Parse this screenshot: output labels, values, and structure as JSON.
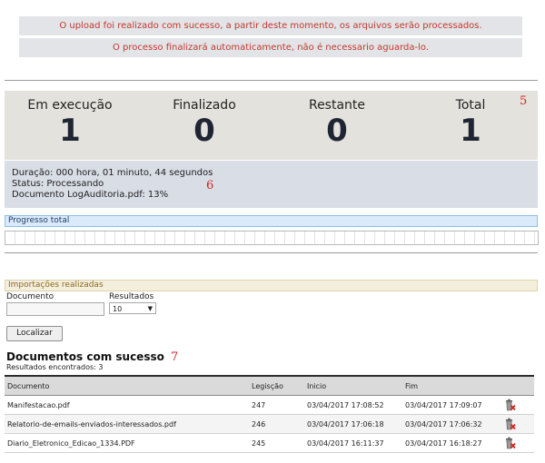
{
  "messages": [
    "O upload foi realizado com sucesso, a partir deste momento, os arquivos serão processados.",
    "O processo finalizará automaticamente, não é necessario aguarda-lo."
  ],
  "stats": {
    "em_execucao": {
      "label": "Em execução",
      "value": "1"
    },
    "finalizado": {
      "label": "Finalizado",
      "value": "0"
    },
    "restante": {
      "label": "Restante",
      "value": "0"
    },
    "total": {
      "label": "Total",
      "value": "1"
    }
  },
  "annotations": {
    "stats": "5",
    "info": "6",
    "documents": "7"
  },
  "info": {
    "duracao": "Duração: 000 hora, 01 minuto, 44 segundos",
    "status": "Status: Processando",
    "documento": "Documento LogAuditoria.pdf: 13%"
  },
  "progress": {
    "label": "Progresso total"
  },
  "importacoes": {
    "header": "Importações realizadas",
    "documento_label": "Documento",
    "documento_value": "",
    "resultados_label": "Resultados",
    "resultados_value": "10",
    "search_button": "Localizar"
  },
  "documents": {
    "title": "Documentos com sucesso",
    "count": "Resultados encontrados: 3",
    "columns": [
      "Documento",
      "Legisção",
      "Inicio",
      "Fim"
    ],
    "rows": [
      {
        "documento": "Manifestacao.pdf",
        "legiscao": "247",
        "inicio": "03/04/2017 17:08:52",
        "fim": "03/04/2017 17:09:07"
      },
      {
        "documento": "Relatorio-de-emails-enviados-interessados.pdf",
        "legiscao": "246",
        "inicio": "03/04/2017 17:06:18",
        "fim": "03/04/2017 17:06:32"
      },
      {
        "documento": "Diario_Eletronico_Edicao_1334.PDF",
        "legiscao": "245",
        "inicio": "03/04/2017 16:11:37",
        "fim": "03/04/2017 16:18:27"
      }
    ]
  },
  "icons": {
    "delete": "trash-delete-icon"
  },
  "colors": {
    "message_text": "#c0392b",
    "annotation_red": "#d42020",
    "delete_x": "#d0271d"
  }
}
